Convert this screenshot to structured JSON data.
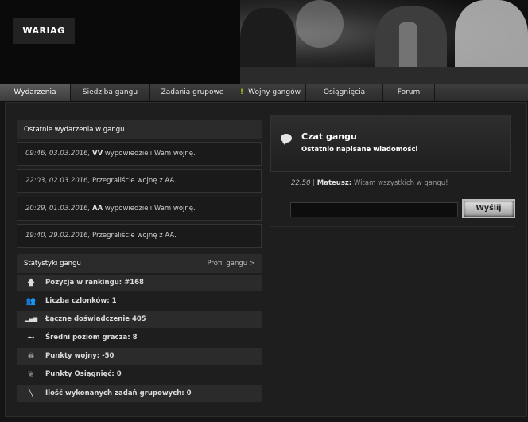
{
  "logo": "WARIAG",
  "nav": [
    {
      "label": "Wydarzenia",
      "active": true
    },
    {
      "label": "Siedziba gangu"
    },
    {
      "label": "Zadania grupowe"
    },
    {
      "label": "Wojny gangów",
      "alert": "!"
    },
    {
      "label": "Osiągnięcia"
    },
    {
      "label": "Forum"
    }
  ],
  "events": {
    "title": "Ostatnie wydarzenia w gangu",
    "items": [
      {
        "time": "09:46, 03.03.2016,",
        "actor": "VV",
        "text": "wypowiedzieli Wam wojnę."
      },
      {
        "time": "22:03, 02.03.2016,",
        "actor": "",
        "text": "Przegraliście wojnę z AA."
      },
      {
        "time": "20:29, 01.03.2016,",
        "actor": "AA",
        "text": "wypowiedzieli Wam wojnę."
      },
      {
        "time": "19:40, 29.02.2016,",
        "actor": "",
        "text": "Przegraliście wojnę z AA."
      }
    ]
  },
  "stats": {
    "title": "Statystyki gangu",
    "profile_link": "Profil gangu >",
    "items": [
      {
        "icon": "arrow-up-icon",
        "glyph": "🡅",
        "text": "Pozycja w rankingu: #168"
      },
      {
        "icon": "members-icon",
        "glyph": "👥",
        "text": "Liczba członków: 1"
      },
      {
        "icon": "bars-icon",
        "glyph": "▂▄▆",
        "text": "Łączne doświadczenie 405"
      },
      {
        "icon": "wave-icon",
        "glyph": "∼",
        "text": "Średni poziom gracza: 8"
      },
      {
        "icon": "skull-icon",
        "glyph": "☠",
        "text": "Punkty wojny: -50"
      },
      {
        "icon": "wings-icon",
        "glyph": "❦",
        "text": "Punkty Osiągnięć: 0"
      },
      {
        "icon": "knife-icon",
        "glyph": "╲",
        "text": "Ilość wykonanych zadań grupowych: 0"
      }
    ]
  },
  "chat": {
    "title": "Czat gangu",
    "subtitle": "Ostatnio napisane wiadomości",
    "message": {
      "time": "22:50",
      "sep": "|",
      "user": "Mateusz:",
      "text": "Witam wszystkich w gangu!"
    },
    "input_value": "",
    "send_label": "Wyślij"
  }
}
